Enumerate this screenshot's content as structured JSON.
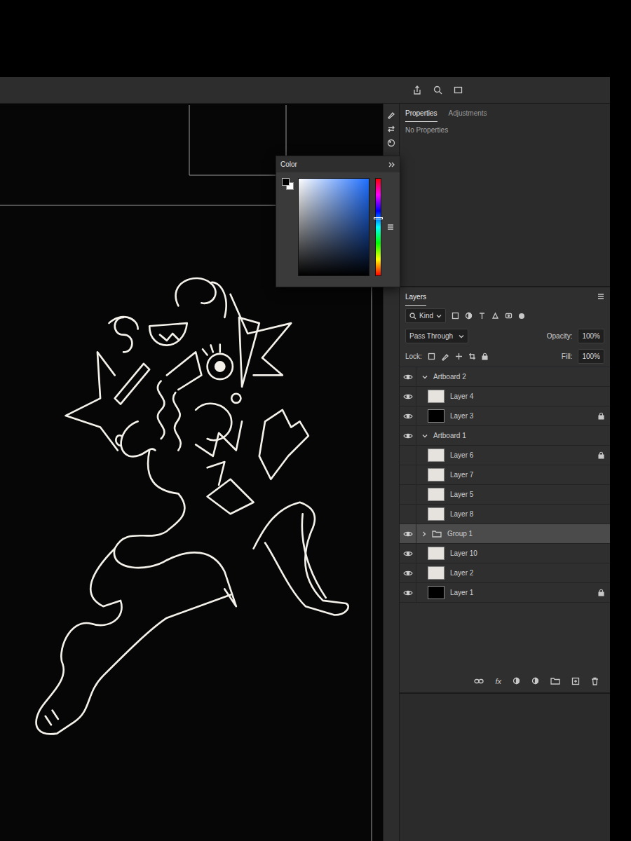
{
  "properties": {
    "tabs": [
      {
        "label": "Properties",
        "selected": true
      },
      {
        "label": "Adjustments",
        "selected": false
      }
    ],
    "message": "No Properties"
  },
  "color_panel": {
    "title": "Color",
    "hue": 0.4
  },
  "layers": {
    "title": "Layers",
    "filter": "Kind",
    "blend_mode": "Pass Through",
    "opacity_label": "Opacity:",
    "opacity": "100%",
    "lock_label": "Lock:",
    "fill_label": "Fill:",
    "fill": "100%",
    "items": [
      {
        "name": "Artboard 2",
        "kind": "artboard",
        "visible": true,
        "expanded": true,
        "locked": false,
        "selected": false
      },
      {
        "name": "Layer 4",
        "kind": "layer",
        "visible": true,
        "locked": false,
        "selected": false,
        "color": "#e6e3de"
      },
      {
        "name": "Layer 3",
        "kind": "layer",
        "visible": true,
        "locked": true,
        "selected": false,
        "color": "#000000"
      },
      {
        "name": "Artboard 1",
        "kind": "artboard",
        "visible": true,
        "expanded": true,
        "locked": false,
        "selected": false
      },
      {
        "name": "Layer 6",
        "kind": "layer",
        "visible": false,
        "locked": true,
        "selected": false,
        "color": "#e6e3de"
      },
      {
        "name": "Layer 7",
        "kind": "layer",
        "visible": false,
        "locked": false,
        "selected": false,
        "color": "#e6e3de"
      },
      {
        "name": "Layer 5",
        "kind": "layer",
        "visible": false,
        "locked": false,
        "selected": false,
        "color": "#e6e3de"
      },
      {
        "name": "Layer 8",
        "kind": "layer",
        "visible": false,
        "locked": false,
        "selected": false,
        "color": "#e6e3de"
      },
      {
        "name": "Group 1",
        "kind": "group",
        "visible": true,
        "expanded": false,
        "locked": false,
        "selected": true
      },
      {
        "name": "Layer 10",
        "kind": "layer",
        "visible": true,
        "locked": false,
        "selected": false,
        "color": "#e6e3de"
      },
      {
        "name": "Layer 2",
        "kind": "layer",
        "visible": true,
        "locked": false,
        "selected": false,
        "color": "#e6e3de"
      },
      {
        "name": "Layer 1",
        "kind": "layer",
        "visible": true,
        "locked": true,
        "selected": false,
        "color": "#000000"
      }
    ],
    "footer": "fx"
  }
}
